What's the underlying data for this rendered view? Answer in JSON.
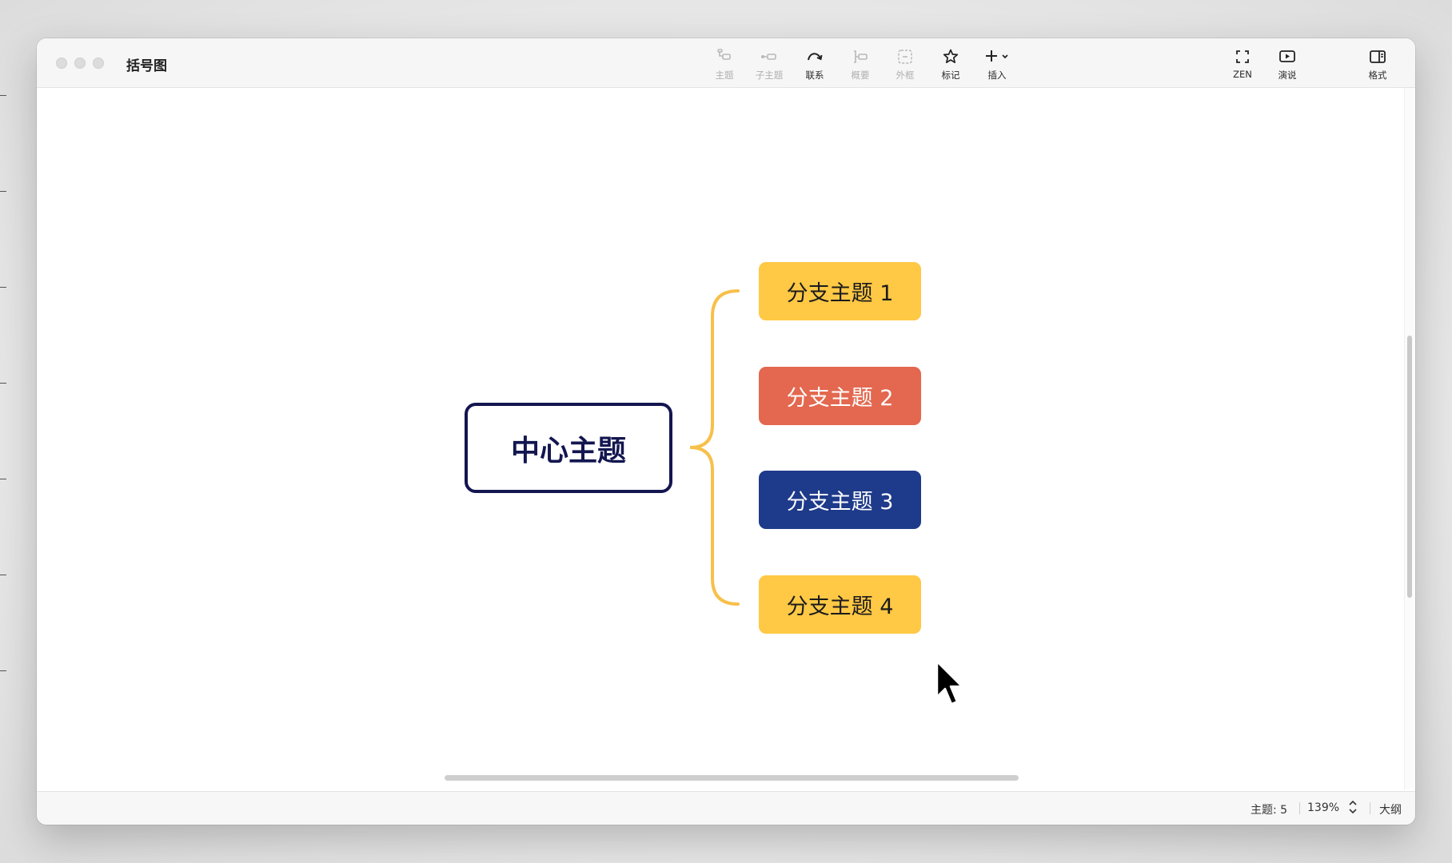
{
  "window": {
    "title": "括号图"
  },
  "toolbar": {
    "topic": "主题",
    "subtopic": "子主题",
    "relationship": "联系",
    "summary": "概要",
    "boundary": "外框",
    "marker": "标记",
    "insert": "插入",
    "zen": "ZEN",
    "pitch": "演说",
    "format": "格式"
  },
  "map": {
    "central_topic": "中心主题",
    "branches": [
      {
        "label": "分支主题 1",
        "fill": "#FFC845",
        "text_color": "#1b1b1b"
      },
      {
        "label": "分支主题 2",
        "fill": "#E3684F",
        "text_color": "#ffffff"
      },
      {
        "label": "分支主题 3",
        "fill": "#1E3A8A",
        "text_color": "#ffffff"
      },
      {
        "label": "分支主题 4",
        "fill": "#FFC845",
        "text_color": "#1b1b1b"
      }
    ],
    "bracket_color": "#F7C04A",
    "central_border_color": "#13164F"
  },
  "status": {
    "topic_count": "主题: 5",
    "zoom": "139%",
    "outline": "大纲"
  }
}
